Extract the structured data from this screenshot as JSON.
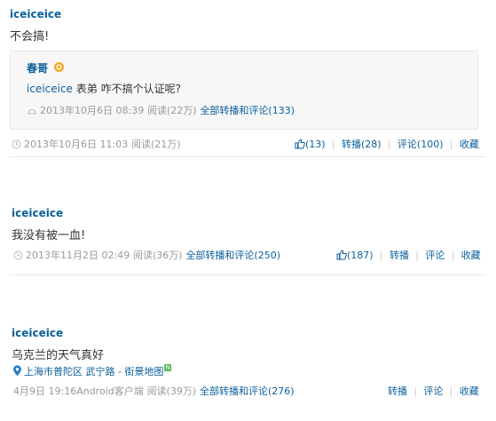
{
  "posts": [
    {
      "author": "iceiceice",
      "text": "不会搞!",
      "quote": {
        "author": "春哥",
        "mention": "iceiceice",
        "text": " 表弟 咋不搞个认证呢?",
        "time": "2013年10月6日 08:39",
        "reads": "阅读(22万)",
        "repost_link": "全部转播和评论(133)"
      },
      "time": "2013年10月6日 11:03",
      "reads": "阅读(21万)",
      "actions": {
        "like": "(13)",
        "repost": "转播(28)",
        "comment": "评论(100)",
        "fav": "收藏"
      }
    },
    {
      "author": "iceiceice",
      "text": "我没有被一血!",
      "time": "2013年11月2日 02:49",
      "reads": "阅读(36万)",
      "repost_link": "全部转播和评论(250)",
      "actions": {
        "like": "(187)",
        "repost": "转播",
        "comment": "评论",
        "fav": "收藏"
      }
    },
    {
      "author": "iceiceice",
      "text": "乌克兰的天气真好",
      "location": "上海市普陀区 武宁路 - 街景地图",
      "location_badge": "N",
      "time": "4月9日 19:16",
      "client": "Android客户端",
      "reads": "阅读(39万)",
      "repost_link": "全部转播和评论(276)",
      "actions": {
        "repost": "转播",
        "comment": "评论",
        "fav": "收藏"
      }
    }
  ],
  "icons": {
    "quote_badge": "vip-badge-icon",
    "clock": "clock-icon",
    "thumb": "thumbs-up-icon",
    "pin": "location-pin-icon"
  },
  "colors": {
    "link": "#0a5f9c",
    "meta": "#999999",
    "badge": "#f5a623",
    "map_badge": "#5cb85c"
  }
}
